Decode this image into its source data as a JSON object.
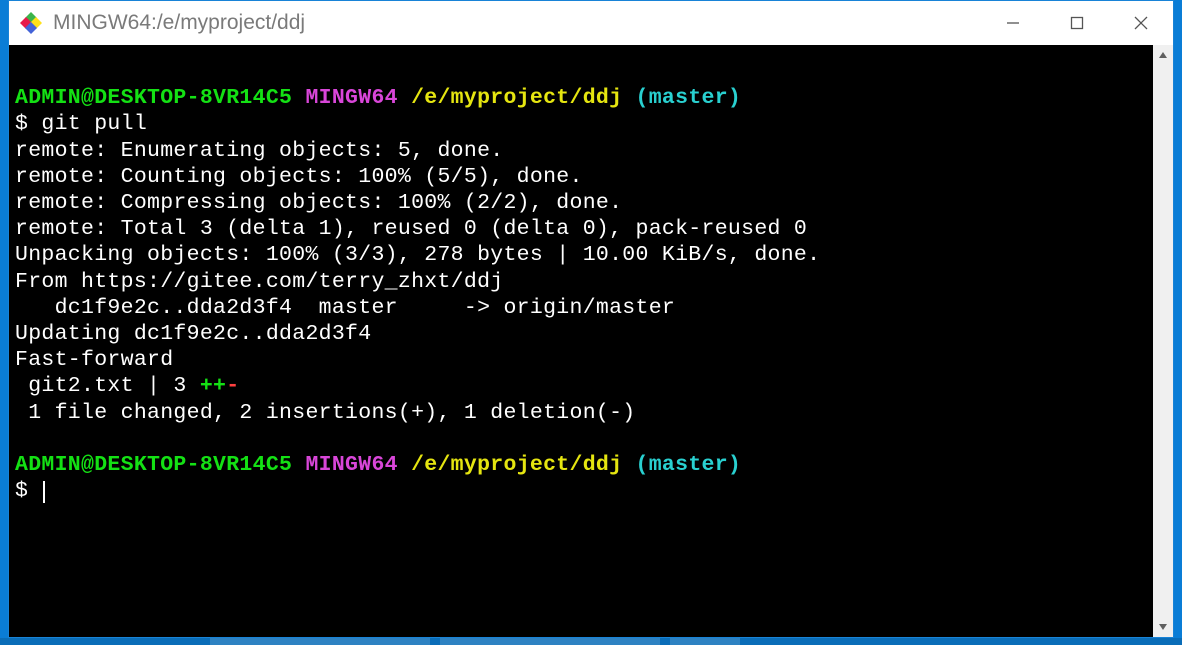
{
  "window": {
    "title": "MINGW64:/e/myproject/ddj"
  },
  "prompt1": {
    "user_host": "ADMIN@DESKTOP-8VR14C5",
    "shell": "MINGW64",
    "path": "/e/myproject/ddj",
    "branch": "(master)",
    "command": "$ git pull"
  },
  "output": {
    "l1": "remote: Enumerating objects: 5, done.",
    "l2": "remote: Counting objects: 100% (5/5), done.",
    "l3": "remote: Compressing objects: 100% (2/2), done.",
    "l4": "remote: Total 3 (delta 1), reused 0 (delta 0), pack-reused 0",
    "l5": "Unpacking objects: 100% (3/3), 278 bytes | 10.00 KiB/s, done.",
    "l6": "From https://gitee.com/terry_zhxt/ddj",
    "l7": "   dc1f9e2c..dda2d3f4  master     -> origin/master",
    "l8": "Updating dc1f9e2c..dda2d3f4",
    "l9": "Fast-forward",
    "stat_file": " git2.txt | 3 ",
    "stat_plus": "++",
    "stat_minus": "-",
    "l11": " 1 file changed, 2 insertions(+), 1 deletion(-)"
  },
  "prompt2": {
    "user_host": "ADMIN@DESKTOP-8VR14C5",
    "shell": "MINGW64",
    "path": "/e/myproject/ddj",
    "branch": "(master)",
    "command": "$ "
  }
}
